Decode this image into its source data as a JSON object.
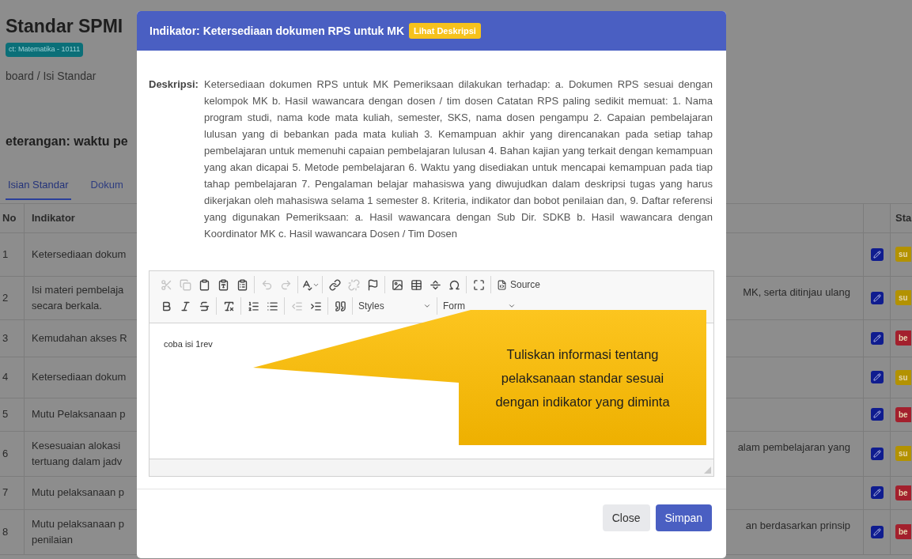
{
  "page": {
    "title": "Standar SPMI",
    "unit_badge": "ct: Matematika - 10111",
    "breadcrumb": "board / Isi Standar",
    "section_heading": "eterangan: waktu pe"
  },
  "tabs": [
    {
      "label": "Isian Standar",
      "selected": true
    },
    {
      "label": "Dokum",
      "selected": false
    }
  ],
  "table": {
    "columns": [
      "No",
      "Indikator",
      "Sta"
    ],
    "rows": [
      {
        "no": "1",
        "indikator": [
          "Ketersediaan dokum"
        ],
        "indikator_right": "",
        "status": "su",
        "color": "#b39200"
      },
      {
        "no": "2",
        "indikator": [
          "Isi materi pembelaja",
          "secara berkala."
        ],
        "indikator_right": "MK, serta ditinjau ulang",
        "status": "su",
        "color": "#b39200"
      },
      {
        "no": "3",
        "indikator": [
          "Kemudahan akses R"
        ],
        "indikator_right": "",
        "status": "be",
        "color": "#a3202d"
      },
      {
        "no": "4",
        "indikator": [
          "Ketersediaan dokum"
        ],
        "indikator_right": "",
        "status": "su",
        "color": "#b39200"
      },
      {
        "no": "5",
        "indikator": [
          "Mutu Pelaksanaan p"
        ],
        "indikator_right": "",
        "status": "be",
        "color": "#a3202d"
      },
      {
        "no": "6",
        "indikator": [
          "Kesesuaian alokasi",
          "tertuang dalam jadv"
        ],
        "indikator_right": "alam pembelajaran yang",
        "status": "su",
        "color": "#b39200"
      },
      {
        "no": "7",
        "indikator": [
          "Mutu pelaksanaan p"
        ],
        "indikator_right": "",
        "status": "be",
        "color": "#a3202d"
      },
      {
        "no": "8",
        "indikator": [
          "Mutu pelaksanaan p",
          "penilaian"
        ],
        "indikator_right": "an berdasarkan prinsip",
        "status": "be",
        "color": "#a3202d"
      }
    ]
  },
  "modal": {
    "title": "Indikator: Ketersediaan dokumen RPS untuk MK",
    "header_badge": "Lihat Deskripsi",
    "description_label": "Deskripsi:",
    "description": "Ketersediaan dokumen RPS untuk MK Pemeriksaan dilakukan terhadap: a. Dokumen RPS sesuai dengan kelompok MK b. Hasil wawancara dengan dosen / tim dosen Catatan RPS paling sedikit memuat: 1. Nama program studi, nama kode mata kuliah, semester, SKS, nama dosen pengampu 2. Capaian pembelajaran lulusan yang di bebankan pada mata kuliah 3. Kemampuan akhir yang direncanakan pada setiap tahap pembelajaran untuk memenuhi capaian pembelajaran lulusan 4. Bahan kajian yang terkait dengan kemampuan yang akan dicapai 5. Metode pembelajaran 6. Waktu yang disediakan untuk mencapai kemampuan pada tiap tahap pembelajaran 7. Pengalaman belajar mahasiswa yang diwujudkan dalam deskripsi tugas yang harus dikerjakan oleh mahasiswa selama 1 semester 8. Kriteria, indikator dan bobot penilaian dan, 9. Daftar referensi yang digunakan Pemeriksaan: a. Hasil wawancara dengan Sub Dir. SDKB b. Hasil wawancara dengan Koordinator MK c. Hasil wawancara Dosen / Tim Dosen",
    "editor": {
      "toolbar": [
        [
          [
            {
              "kind": "cut",
              "disabled": true
            },
            {
              "kind": "copy",
              "disabled": true
            },
            {
              "kind": "paste",
              "disabled": false
            },
            {
              "kind": "paste-text",
              "disabled": false
            },
            {
              "kind": "paste-word",
              "disabled": false
            }
          ],
          [
            {
              "kind": "undo",
              "disabled": true
            },
            {
              "kind": "redo",
              "disabled": true
            }
          ],
          [
            {
              "kind": "spellcheck",
              "disabled": false
            }
          ],
          [
            {
              "kind": "link",
              "disabled": false
            },
            {
              "kind": "unlink",
              "disabled": true
            },
            {
              "kind": "anchor",
              "disabled": false
            }
          ],
          [
            {
              "kind": "image",
              "disabled": false
            },
            {
              "kind": "table",
              "disabled": false
            },
            {
              "kind": "rule",
              "disabled": false
            },
            {
              "kind": "special-char",
              "disabled": false
            }
          ],
          [
            {
              "kind": "maximize",
              "disabled": false
            }
          ],
          [
            {
              "kind": "source",
              "label": "Source",
              "disabled": false
            }
          ]
        ],
        [
          [
            {
              "kind": "bold",
              "disabled": false
            },
            {
              "kind": "italic",
              "disabled": false
            },
            {
              "kind": "strike",
              "disabled": false
            }
          ],
          [
            {
              "kind": "remove-format",
              "disabled": false
            }
          ],
          [
            {
              "kind": "numbered-list",
              "disabled": false
            },
            {
              "kind": "bulleted-list",
              "disabled": false
            }
          ],
          [
            {
              "kind": "outdent",
              "disabled": true
            },
            {
              "kind": "indent",
              "disabled": false
            }
          ],
          [
            {
              "kind": "blockquote",
              "disabled": false
            }
          ],
          [
            {
              "kind": "dropdown",
              "label": "Styles",
              "disabled": false
            }
          ],
          [
            {
              "kind": "dropdown",
              "label": "Form",
              "disabled": false
            }
          ]
        ]
      ],
      "value": "coba isi 1rev"
    },
    "callout": "Tuliskan informasi tentang pelaksanaan standar sesuai dengan indikator yang diminta",
    "buttons": [
      {
        "label": "Close",
        "kind": "secondary"
      },
      {
        "label": "Simpan",
        "kind": "primary"
      }
    ]
  }
}
